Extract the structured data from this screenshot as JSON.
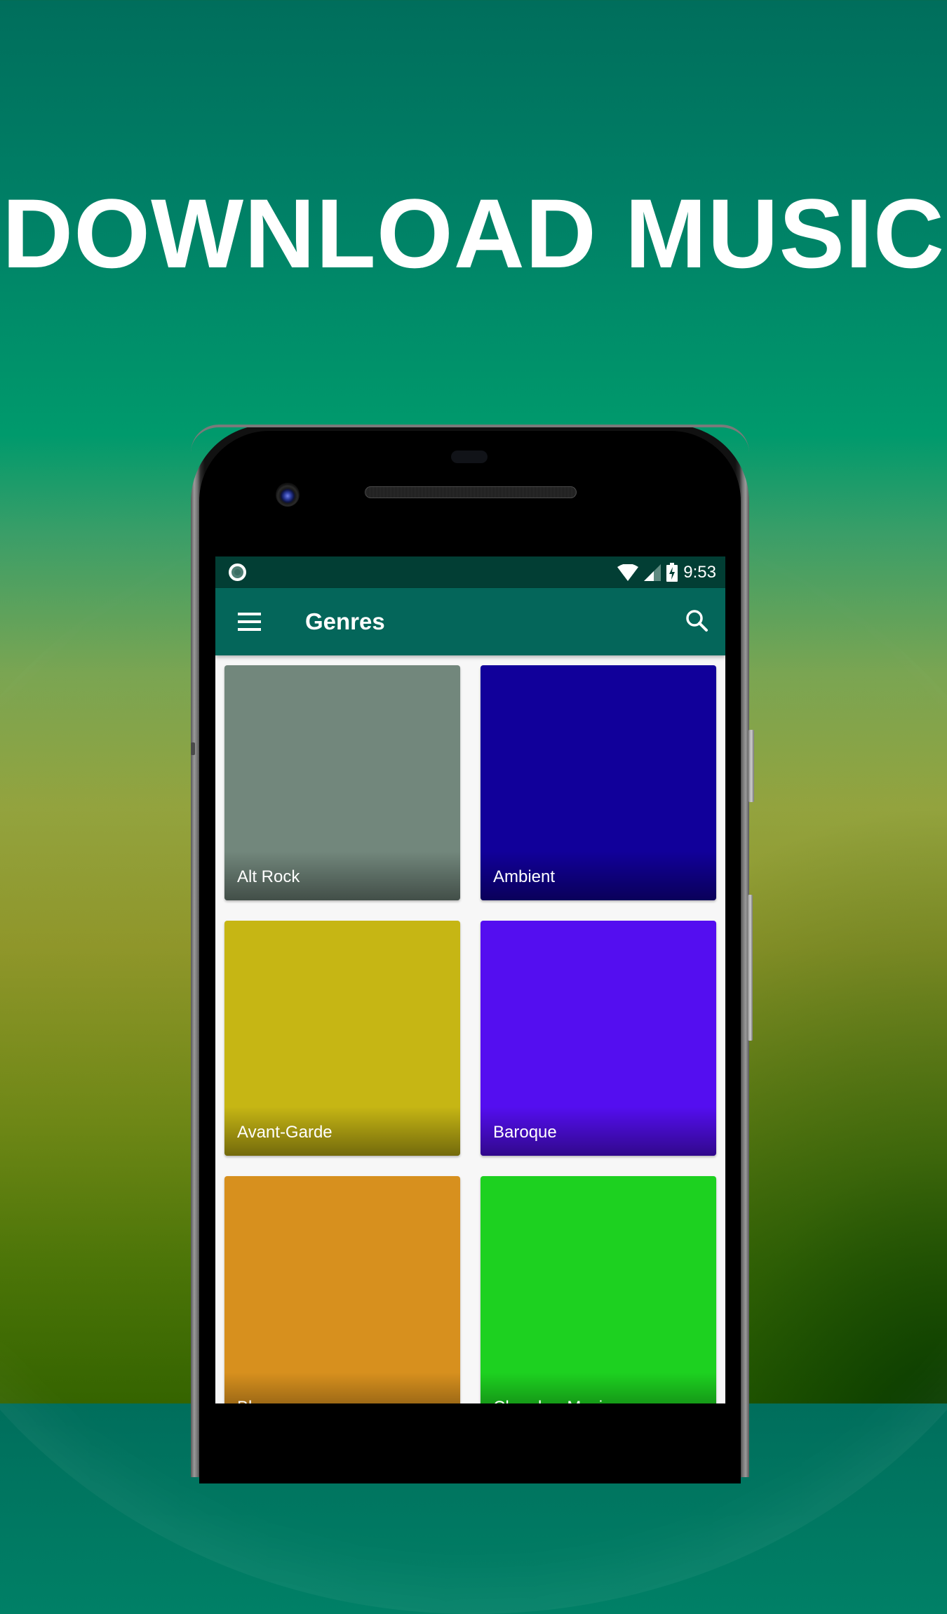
{
  "promo": {
    "headline": "DOWNLOAD MUSIC"
  },
  "status_bar": {
    "notification_icon": "circle-notification-icon",
    "wifi_icon": "wifi-icon",
    "signal_icon": "cell-signal-icon",
    "battery_icon": "battery-charging-icon",
    "time": "9:53"
  },
  "toolbar": {
    "menu_icon": "hamburger-menu-icon",
    "title": "Genres",
    "search_icon": "search-icon",
    "background": "#04665a"
  },
  "genres": [
    {
      "label": "Alt Rock",
      "color": "#72877c"
    },
    {
      "label": "Ambient",
      "color": "#11009a"
    },
    {
      "label": "Avant-Garde",
      "color": "#c6b614"
    },
    {
      "label": "Baroque",
      "color": "#540ef0"
    },
    {
      "label": "Blues",
      "color": "#d7901e"
    },
    {
      "label": "Chamber Music",
      "color": "#1dd120"
    }
  ]
}
